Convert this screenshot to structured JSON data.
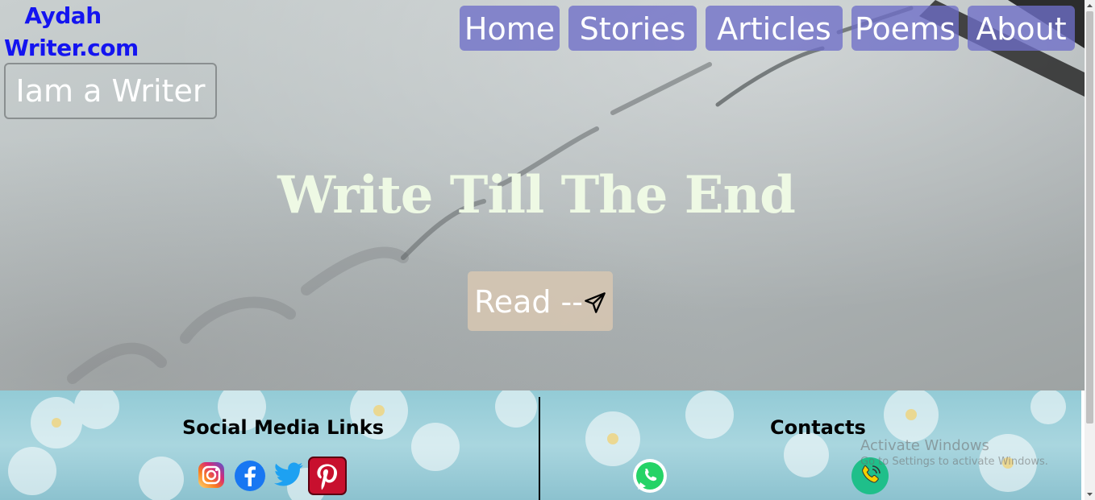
{
  "site": {
    "logo_line1": "Aydah",
    "logo_line2": "Writer.com",
    "tagline": "Iam a Writer"
  },
  "nav": {
    "items": [
      {
        "label": "Home"
      },
      {
        "label": "Stories"
      },
      {
        "label": "Articles"
      },
      {
        "label": "Poems"
      },
      {
        "label": "About"
      }
    ]
  },
  "hero": {
    "headline": "Write Till The End",
    "read_label": "Read --",
    "read_icon": "paper-plane-icon"
  },
  "footer": {
    "social_title": "Social Media Links",
    "contacts_title": "Contacts",
    "social_icons": [
      "instagram-icon",
      "facebook-icon",
      "twitter-icon",
      "pinterest-icon"
    ],
    "contact_icons": [
      "whatsapp-icon",
      "phone-icon"
    ]
  },
  "os_overlay": {
    "line1": "Activate Windows",
    "line2": "Go to Settings to activate Windows."
  },
  "colors": {
    "logo": "#1414f0",
    "nav_bg": "#6e6ec8",
    "headline": "#eef9e4",
    "read_bg": "#d6c6b2",
    "footer_bg": "#a9d6df"
  }
}
